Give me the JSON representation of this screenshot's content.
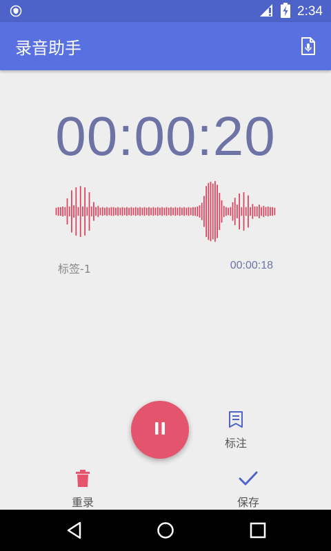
{
  "status_bar": {
    "time": "2:34",
    "icons": [
      "shield-icon",
      "signal-icon",
      "battery-charging-icon"
    ]
  },
  "app_bar": {
    "title": "录音助手",
    "action_icon": "recording-file-icon"
  },
  "timer": {
    "elapsed": "00:00:20"
  },
  "waveform": {
    "color": "#d9435c",
    "amplitudes": [
      0.12,
      0.14,
      0.14,
      0.16,
      0.14,
      0.42,
      0.16,
      0.68,
      0.2,
      0.78,
      0.14,
      0.82,
      0.16,
      0.78,
      0.14,
      0.62,
      0.16,
      0.3,
      0.14,
      0.18,
      0.12,
      0.14,
      0.12,
      0.14,
      0.12,
      0.14,
      0.14,
      0.12,
      0.14,
      0.12,
      0.14,
      0.12,
      0.14,
      0.12,
      0.14,
      0.12,
      0.14,
      0.12,
      0.14,
      0.12,
      0.14,
      0.12,
      0.14,
      0.12,
      0.14,
      0.12,
      0.14,
      0.12,
      0.14,
      0.12,
      0.14,
      0.12,
      0.14,
      0.12,
      0.14,
      0.12,
      0.14,
      0.12,
      0.14,
      0.12,
      0.14,
      0.12,
      0.14,
      0.14,
      0.16,
      0.2,
      0.28,
      0.5,
      0.82,
      0.92,
      0.96,
      0.9,
      0.98,
      0.86,
      0.6,
      0.36,
      0.18,
      0.14,
      0.12,
      0.14,
      0.3,
      0.44,
      0.22,
      0.58,
      0.14,
      0.62,
      0.14,
      0.52,
      0.14,
      0.24,
      0.16,
      0.16,
      0.22,
      0.14,
      0.18,
      0.14,
      0.16,
      0.14,
      0.14,
      0.12
    ]
  },
  "mark": {
    "label": "标签-1",
    "time": "00:00:18"
  },
  "controls": {
    "pause_icon": "pause-icon",
    "mark_label": "标注",
    "rerecord_label": "重录",
    "save_label": "保存"
  },
  "colors": {
    "primary": "#5870e0",
    "accent": "#e5546d",
    "timer": "#6e73a6"
  },
  "nav": {
    "icons": [
      "back-icon",
      "home-icon",
      "recents-icon"
    ]
  }
}
